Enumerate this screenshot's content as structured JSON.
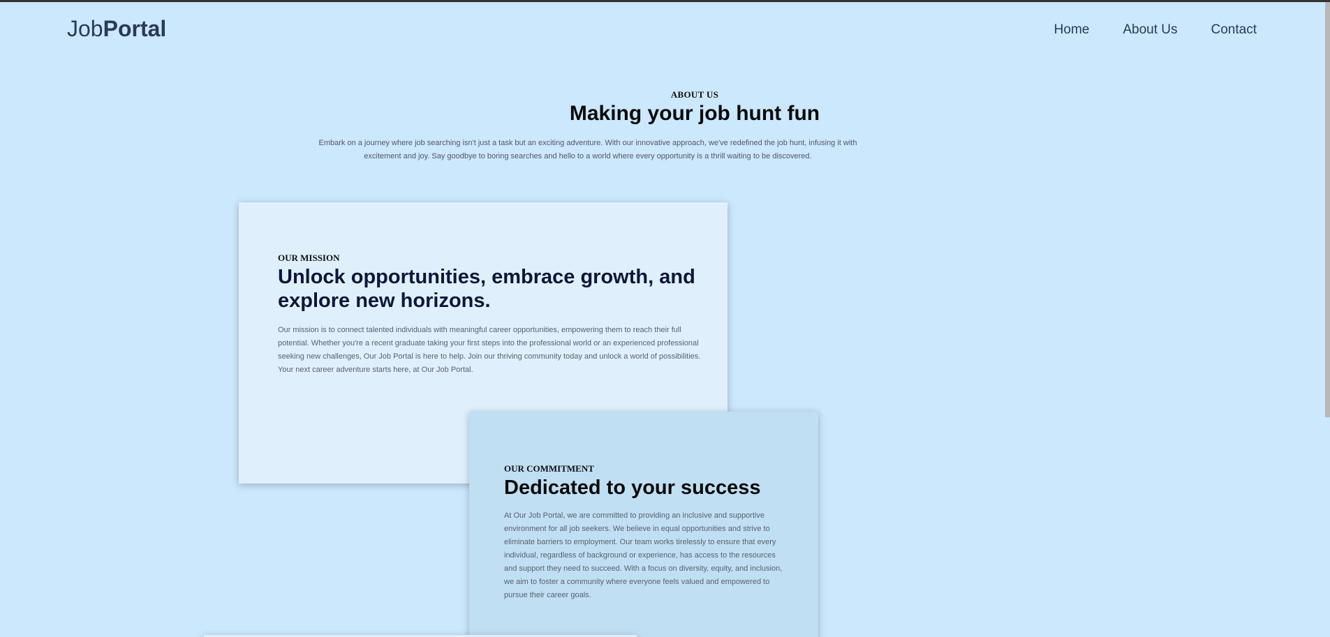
{
  "header": {
    "logo_part1": "Job",
    "logo_part2": "Portal",
    "nav": [
      "Home",
      "About Us",
      "Contact"
    ]
  },
  "about": {
    "eyebrow": "ABOUT US",
    "title": "Making your job hunt fun",
    "description": "Embark on a journey where job searching isn't just a task but an exciting adventure. With our innovative approach, we've redefined the job hunt, infusing it with excitement and joy. Say goodbye to boring searches and hello to a world where every opportunity is a thrill waiting to be discovered."
  },
  "mission": {
    "eyebrow": "OUR MISSION",
    "title": "Unlock opportunities, embrace growth, and explore new horizons.",
    "text": "Our mission is to connect talented individuals with meaningful career opportunities, empowering them to reach their full potential. Whether you're a recent graduate taking your first steps into the professional world or an experienced professional seeking new challenges, Our Job Portal is here to help. Join our thriving community today and unlock a world of possibilities. Your next career adventure starts here, at Our Job Portal."
  },
  "commitment": {
    "eyebrow": "OUR COMMITMENT",
    "title": "Dedicated to your success",
    "text": "At Our Job Portal, we are committed to providing an inclusive and supportive environment for all job seekers. We believe in equal opportunities and strive to eliminate barriers to employment. Our team works tirelessly to ensure that every individual, regardless of background or experience, has access to the resources and support they need to succeed. With a focus on diversity, equity, and inclusion, we aim to foster a community where everyone feels valued and empowered to pursue their career goals."
  },
  "colors": {
    "page_bg": "#cbe8fd",
    "mission_card_bg": "#dff0fc",
    "commitment_card_bg": "#c0dff3",
    "text_dark": "#2b3a55"
  }
}
